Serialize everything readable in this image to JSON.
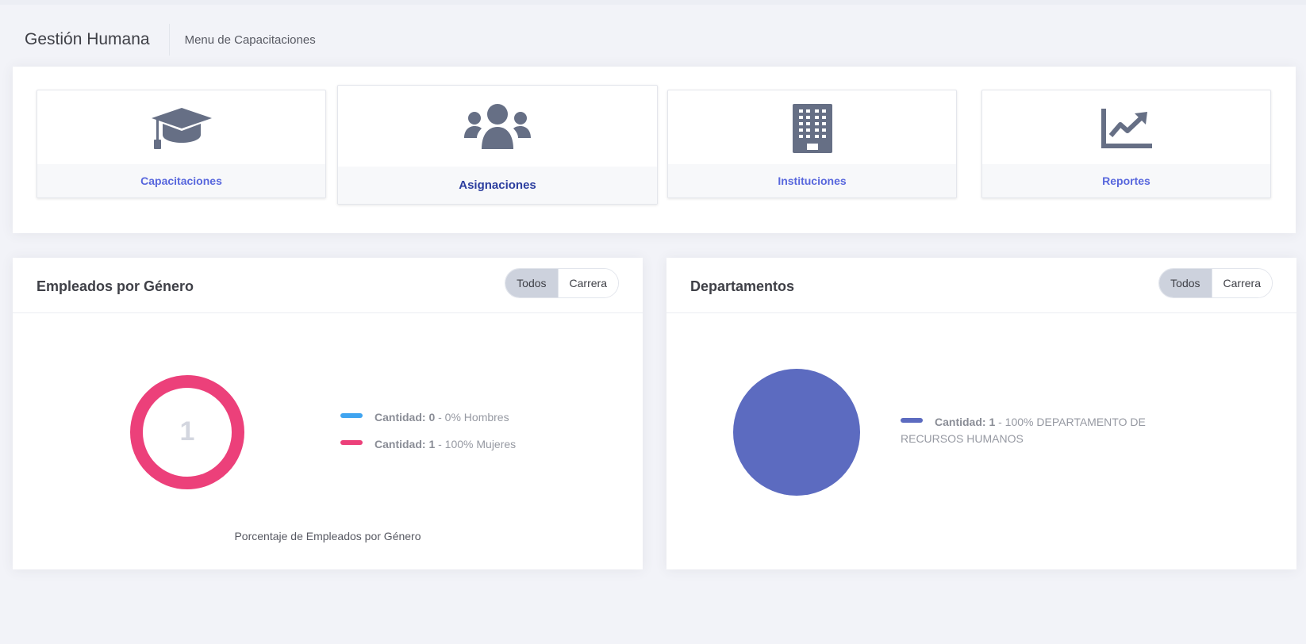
{
  "header": {
    "app_title": "Gestión Humana",
    "breadcrumb": "Menu de Capacitaciones"
  },
  "menu": {
    "items": [
      {
        "label": "Capacitaciones",
        "icon": "graduation-cap-icon"
      },
      {
        "label": "Asignaciones",
        "icon": "users-icon"
      },
      {
        "label": "Instituciones",
        "icon": "building-icon"
      },
      {
        "label": "Reportes",
        "icon": "chart-line-icon"
      }
    ],
    "accent_color": "#5867dd",
    "active_color": "#2c3e9f",
    "icon_color": "#666f85"
  },
  "gender_panel": {
    "title": "Empleados por Género",
    "toggle": {
      "options": [
        "Todos",
        "Carrera"
      ],
      "selected": "Todos"
    },
    "center_value": "1",
    "caption": "Porcentaje de Empleados por Género",
    "legend": [
      {
        "prefix": "Cantidad: 0",
        "suffix": " - 0% Hombres",
        "color": "#3fa4f0"
      },
      {
        "prefix": "Cantidad: 1",
        "suffix": " - 100% Mujeres",
        "color": "#ec407a"
      }
    ]
  },
  "dept_panel": {
    "title": "Departamentos",
    "toggle": {
      "options": [
        "Todos",
        "Carrera"
      ],
      "selected": "Todos"
    },
    "legend": [
      {
        "prefix": "Cantidad: 1",
        "suffix": " - 100% DEPARTAMENTO DE RECURSOS HUMANOS",
        "color": "#5c6bc0"
      }
    ]
  },
  "chart_data": [
    {
      "type": "pie",
      "title": "",
      "categories": [
        "Hombres",
        "Mujeres"
      ],
      "values": [
        0,
        1
      ],
      "colors": [
        "#3fa4f0",
        "#ec407a"
      ],
      "donut": true
    },
    {
      "type": "pie",
      "title": "",
      "categories": [
        "DEPARTAMENTO DE RECURSOS HUMANOS"
      ],
      "values": [
        1
      ],
      "colors": [
        "#5c6bc0"
      ],
      "donut": false
    }
  ]
}
